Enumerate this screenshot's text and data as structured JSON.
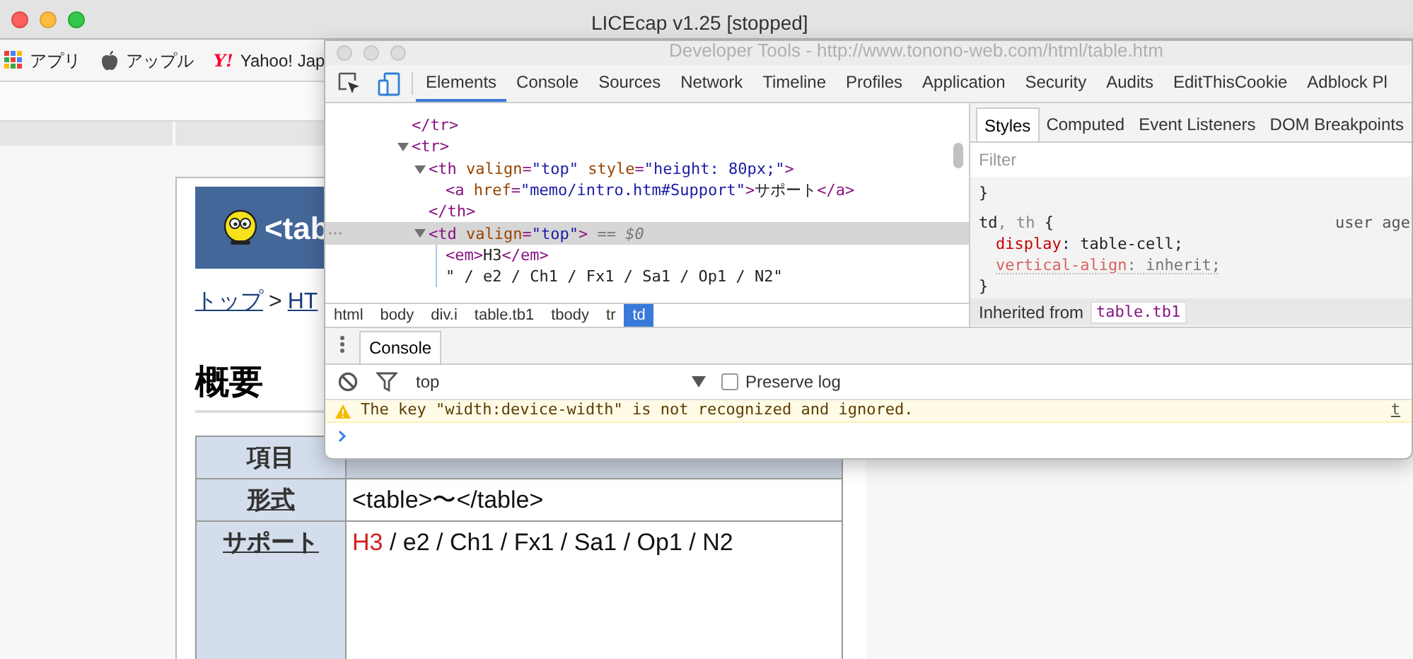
{
  "capture_window": {
    "title": "LICEcap v1.25 [stopped]"
  },
  "bookmarks": [
    {
      "kind": "apps",
      "label": "アプリ"
    },
    {
      "kind": "apple",
      "label": "アップル"
    },
    {
      "kind": "yahoo",
      "logo": "Y!",
      "label": "Yahoo! Jap"
    }
  ],
  "page": {
    "banner_title": "<tab",
    "breadcrumb": [
      {
        "label": "トップ",
        "link": true
      },
      {
        "label": ">",
        "link": false
      },
      {
        "label": "HT",
        "link": true
      }
    ],
    "heading": "概要",
    "table": {
      "columns": [
        "項目"
      ],
      "rows": [
        {
          "header": "形式",
          "value": [
            {
              "text": "<table>〜</table>",
              "emphasized": false
            }
          ]
        },
        {
          "header": "サポート",
          "value": [
            {
              "text": "H3",
              "emphasized": true
            },
            {
              "text": "/ e2 / Ch1 / Fx1 / Sa1 / Op1 / N2",
              "emphasized": false
            }
          ]
        }
      ]
    }
  },
  "devtools": {
    "title": "Developer Tools - http://www.tonono-web.com/html/table.htm",
    "tabs": [
      {
        "label": "Elements",
        "selected": true
      },
      {
        "label": "Console",
        "selected": false
      },
      {
        "label": "Sources",
        "selected": false
      },
      {
        "label": "Network",
        "selected": false
      },
      {
        "label": "Timeline",
        "selected": false
      },
      {
        "label": "Profiles",
        "selected": false
      },
      {
        "label": "Application",
        "selected": false
      },
      {
        "label": "Security",
        "selected": false
      },
      {
        "label": "Audits",
        "selected": false
      },
      {
        "label": "EditThisCookie",
        "selected": false
      },
      {
        "label": "Adblock Pl",
        "selected": false
      }
    ],
    "dom_tree": [
      {
        "selected": false,
        "segments": [
          {
            "kind": "tag",
            "text": "</tr>"
          }
        ]
      },
      {
        "selected": false,
        "expanded": true,
        "segments": [
          {
            "kind": "tag",
            "text": "<tr>"
          }
        ],
        "children": [
          {
            "selected": false,
            "expanded": true,
            "segments": [
              {
                "kind": "tag",
                "text": "<th"
              },
              {
                "kind": "attr",
                "text": " valign"
              },
              {
                "kind": "tag",
                "text": "="
              },
              {
                "kind": "value",
                "text": "\"top\""
              },
              {
                "kind": "attr",
                "text": " style"
              },
              {
                "kind": "tag",
                "text": "="
              },
              {
                "kind": "value",
                "text": "\"height: 80px;\""
              },
              {
                "kind": "tag",
                "text": ">"
              }
            ],
            "children": [
              {
                "selected": false,
                "segments": [
                  {
                    "kind": "tag",
                    "text": "<a"
                  },
                  {
                    "kind": "attr",
                    "text": " href"
                  },
                  {
                    "kind": "tag",
                    "text": "="
                  },
                  {
                    "kind": "value",
                    "text": "\"memo/intro.htm#Support\""
                  },
                  {
                    "kind": "tag",
                    "text": ">"
                  },
                  {
                    "kind": "text",
                    "text": "サポート"
                  },
                  {
                    "kind": "tag",
                    "text": "</a>"
                  }
                ]
              }
            ]
          },
          {
            "selected": false,
            "segments": [
              {
                "kind": "tag",
                "text": "</th>"
              }
            ]
          },
          {
            "selected": true,
            "expanded": true,
            "segments": [
              {
                "kind": "tag",
                "text": "<td"
              },
              {
                "kind": "attr",
                "text": " valign"
              },
              {
                "kind": "tag",
                "text": "="
              },
              {
                "kind": "value",
                "text": "\"top\""
              },
              {
                "kind": "tag",
                "text": ">"
              },
              {
                "kind": "marker",
                "text": " == $0"
              }
            ],
            "children": [
              {
                "selected": false,
                "segments": [
                  {
                    "kind": "tag",
                    "text": "<em>"
                  },
                  {
                    "kind": "text",
                    "text": "H3"
                  },
                  {
                    "kind": "tag",
                    "text": "</em>"
                  }
                ]
              },
              {
                "selected": false,
                "segments": [
                  {
                    "kind": "text",
                    "text": "\" / e2 / Ch1 / Fx1 / Sa1 / Op1 / N2\""
                  }
                ]
              }
            ]
          }
        ]
      }
    ],
    "breadcrumbs": [
      {
        "label": "html",
        "selected": false
      },
      {
        "label": "body",
        "selected": false
      },
      {
        "label": "div.i",
        "selected": false
      },
      {
        "label": "table.tb1",
        "selected": false
      },
      {
        "label": "tbody",
        "selected": false
      },
      {
        "label": "tr",
        "selected": false
      },
      {
        "label": "td",
        "selected": true
      }
    ],
    "styles": {
      "tabs": [
        {
          "label": "Styles",
          "selected": true
        },
        {
          "label": "Computed",
          "selected": false
        },
        {
          "label": "Event Listeners",
          "selected": false
        },
        {
          "label": "DOM Breakpoints",
          "selected": false
        }
      ],
      "filter_placeholder": "Filter",
      "rules": [
        {
          "end": "}"
        },
        {
          "selector": [
            {
              "text": "td",
              "matched": true
            },
            {
              "text": ", th",
              "matched": false
            }
          ],
          "open": "{",
          "origin": "user age",
          "declarations": [
            {
              "property": "display",
              "separator": ":",
              "value": "table-cell;",
              "overridden": false
            },
            {
              "property": "vertical-align",
              "separator": ":",
              "value": "inherit;",
              "overridden": true
            }
          ],
          "end": "}"
        }
      ],
      "inherited": {
        "label": "Inherited from",
        "selector": "table.tb1"
      }
    },
    "console": {
      "tabs": [
        {
          "label": "Console",
          "selected": true
        }
      ],
      "context": "top",
      "preserve_log": {
        "label": "Preserve log",
        "checked": false
      },
      "messages": [
        {
          "kind": "warning",
          "text": "The key \"width:device-width\" is not recognized and ignored.",
          "source": "t"
        }
      ]
    }
  }
}
